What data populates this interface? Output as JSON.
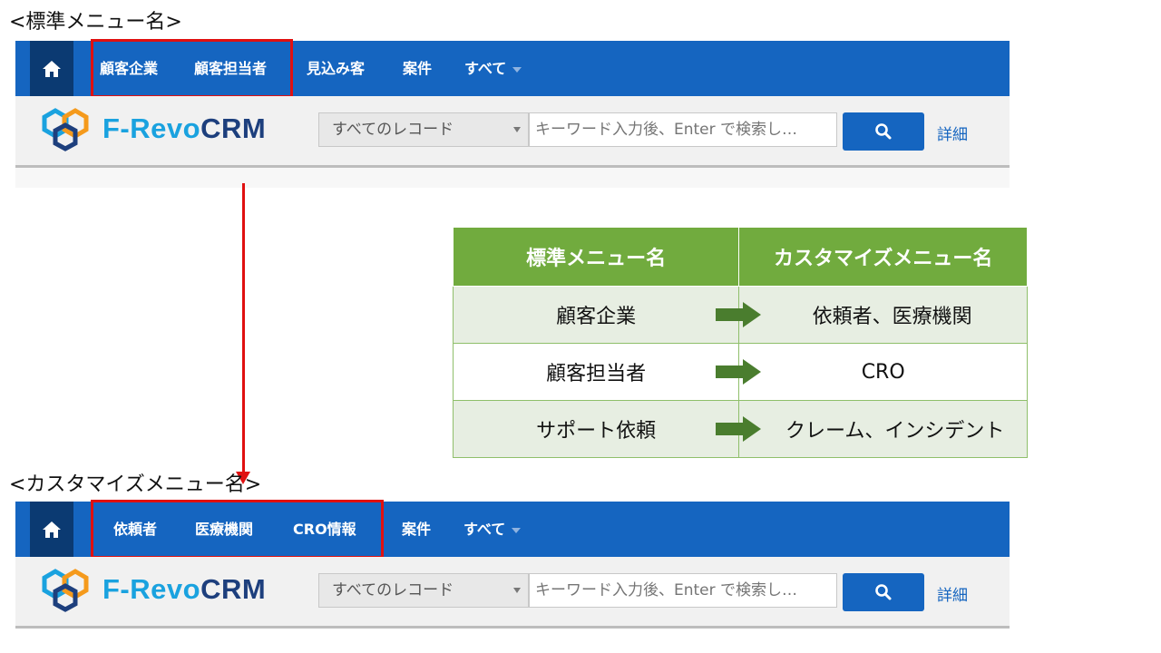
{
  "top": {
    "caption": "<標準メニュー名>",
    "nav": [
      "顧客企業",
      "顧客担当者",
      "見込み客",
      "案件",
      "すべて"
    ]
  },
  "bottom": {
    "caption": "<カスタマイズメニュー名>",
    "nav": [
      "依頼者",
      "医療機関",
      "CRO情報",
      "案件",
      "すべて"
    ]
  },
  "brand": {
    "part1": "F-Revo",
    "part2": "CRM"
  },
  "search": {
    "scope": "すべてのレコード",
    "placeholder": "キーワード入力後、Enter で検索し…",
    "detail": "詳細"
  },
  "mapping_table": {
    "headers": [
      "標準メニュー名",
      "カスタマイズメニュー名"
    ],
    "rows": [
      {
        "standard": "顧客企業",
        "custom": "依頼者、医療機関"
      },
      {
        "standard": "顧客担当者",
        "custom": "CRO"
      },
      {
        "standard": "サポート依頼",
        "custom": "クレーム、インシデント"
      }
    ]
  },
  "colors": {
    "nav_bg": "#1565c0",
    "highlight": "#e01010",
    "table_header": "#71ab3e",
    "arrow_green": "#4a7d2e"
  },
  "icons": [
    "home-icon",
    "logo-icon",
    "search-icon",
    "chevron-down-icon",
    "arrow-right-icon"
  ]
}
